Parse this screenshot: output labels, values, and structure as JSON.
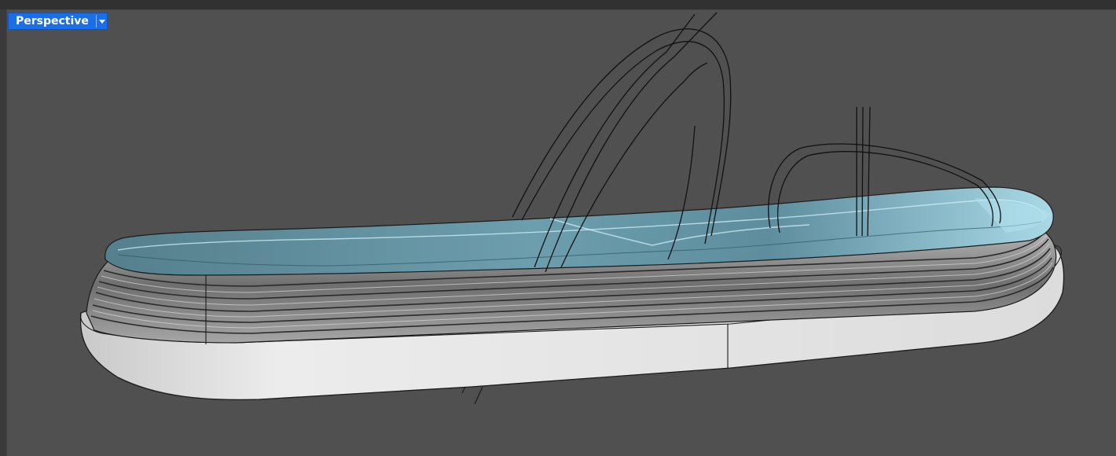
{
  "viewport": {
    "name": "Perspective",
    "background": "#505050",
    "accent": "#1a6ee8"
  },
  "scene": {
    "footbed_color": "#5e8fa0",
    "midsole_color": "#8a8a8a",
    "outsole_color": "#d9d9d9",
    "curve_color": "#111111"
  }
}
